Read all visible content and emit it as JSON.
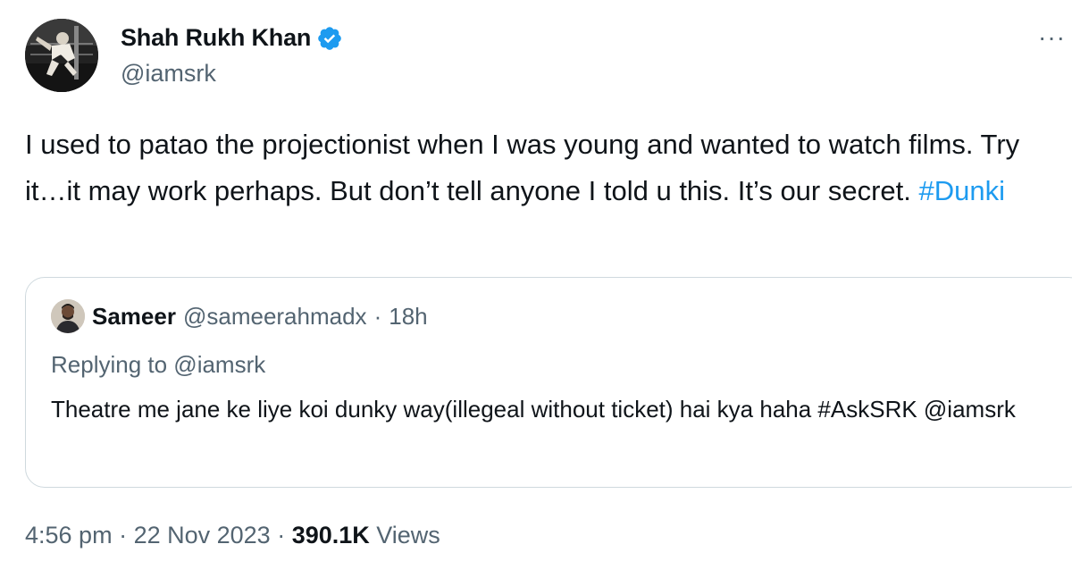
{
  "author": {
    "display_name": "Shah Rukh Khan",
    "handle": "@iamsrk",
    "verified": true
  },
  "tweet": {
    "text": "I used to patao the projectionist when I was young and wanted to watch films. Try it…it may work perhaps. But don’t tell anyone I told u this. It’s our secret. ",
    "hashtag": "#Dunki"
  },
  "quoted_tweet": {
    "author_name": "Sameer",
    "author_handle": "@sameerahmadx",
    "separator": "·",
    "time": "18h",
    "replying_to": "Replying to @iamsrk",
    "text": "Theatre me jane ke liye koi dunky way(illegeal without ticket)  hai kya haha #AskSRK @iamsrk"
  },
  "meta": {
    "time": "4:56 pm",
    "sep1": " · ",
    "date": "22 Nov 2023",
    "sep2": " · ",
    "views_count": "390.1K",
    "views_label": " Views"
  },
  "icons": {
    "more": "more-horizontal-icon",
    "verified": "verified-badge-icon"
  },
  "colors": {
    "link": "#1d9bf0",
    "secondary_text": "#536471",
    "primary_text": "#0f1419",
    "border": "#cfd9de"
  }
}
